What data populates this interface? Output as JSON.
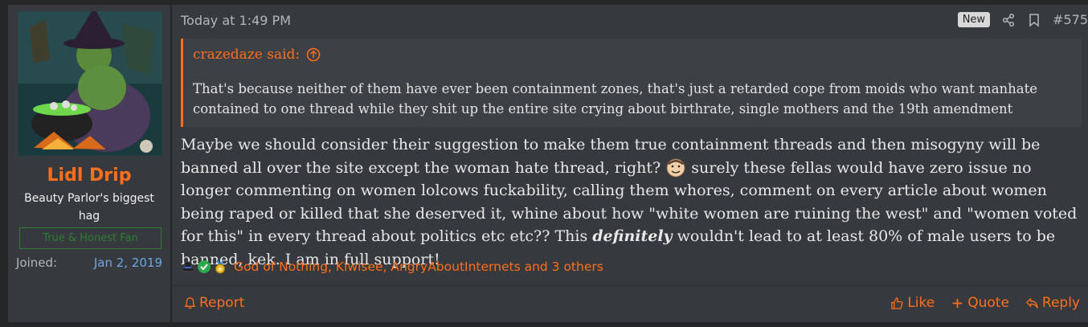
{
  "user": {
    "name": "Lidl Drip",
    "title": "Beauty Parlor's biggest hag",
    "banner": "True & Honest Fan",
    "joined_label": "Joined:",
    "joined_date": "Jan 2, 2019"
  },
  "post": {
    "timestamp": "Today at 1:49 PM",
    "new_badge": "New",
    "number": "#575",
    "quote": {
      "author": "crazedaze said:",
      "body": "That's because neither of them have ever been containment zones, that's just a retarded cope from moids who want manhate contained to one thread while they shit up the entire site crying about birthrate, single mothers and the 19th amendment"
    },
    "message_part1": "Maybe we should consider their suggestion to make them true containment threads and then misogyny will be banned all over the site except the woman hate thread, right?",
    "message_part2": "surely these fellas would have zero issue no longer commenting on women lolcows fuckability, calling them whores, comment on every article about women being raped or killed that she deserved it, whine about how \"white women are ruining the west\" and \"women voted for this\" in every thread about politics etc etc?? This",
    "message_emphasis": "definitely",
    "message_part3": "wouldn't lead to at least 80% of male users to be banned, kek. I am in full support!",
    "reactions_text": "God of Nothing, Kiwisee, AngryAboutInternets and 3 others",
    "reaction_icons": [
      "top-hat-icon",
      "checkmark-icon",
      "medal-icon"
    ]
  },
  "footer": {
    "report": "Report",
    "like": "Like",
    "quote": "Quote",
    "reply": "Reply"
  },
  "colors": {
    "accent": "#ff6f1c",
    "background": "#242628",
    "panel": "#36393d",
    "quote_bg": "#3d4044",
    "link_blue": "#6aa8e8",
    "banner_green": "#2e7d32"
  }
}
